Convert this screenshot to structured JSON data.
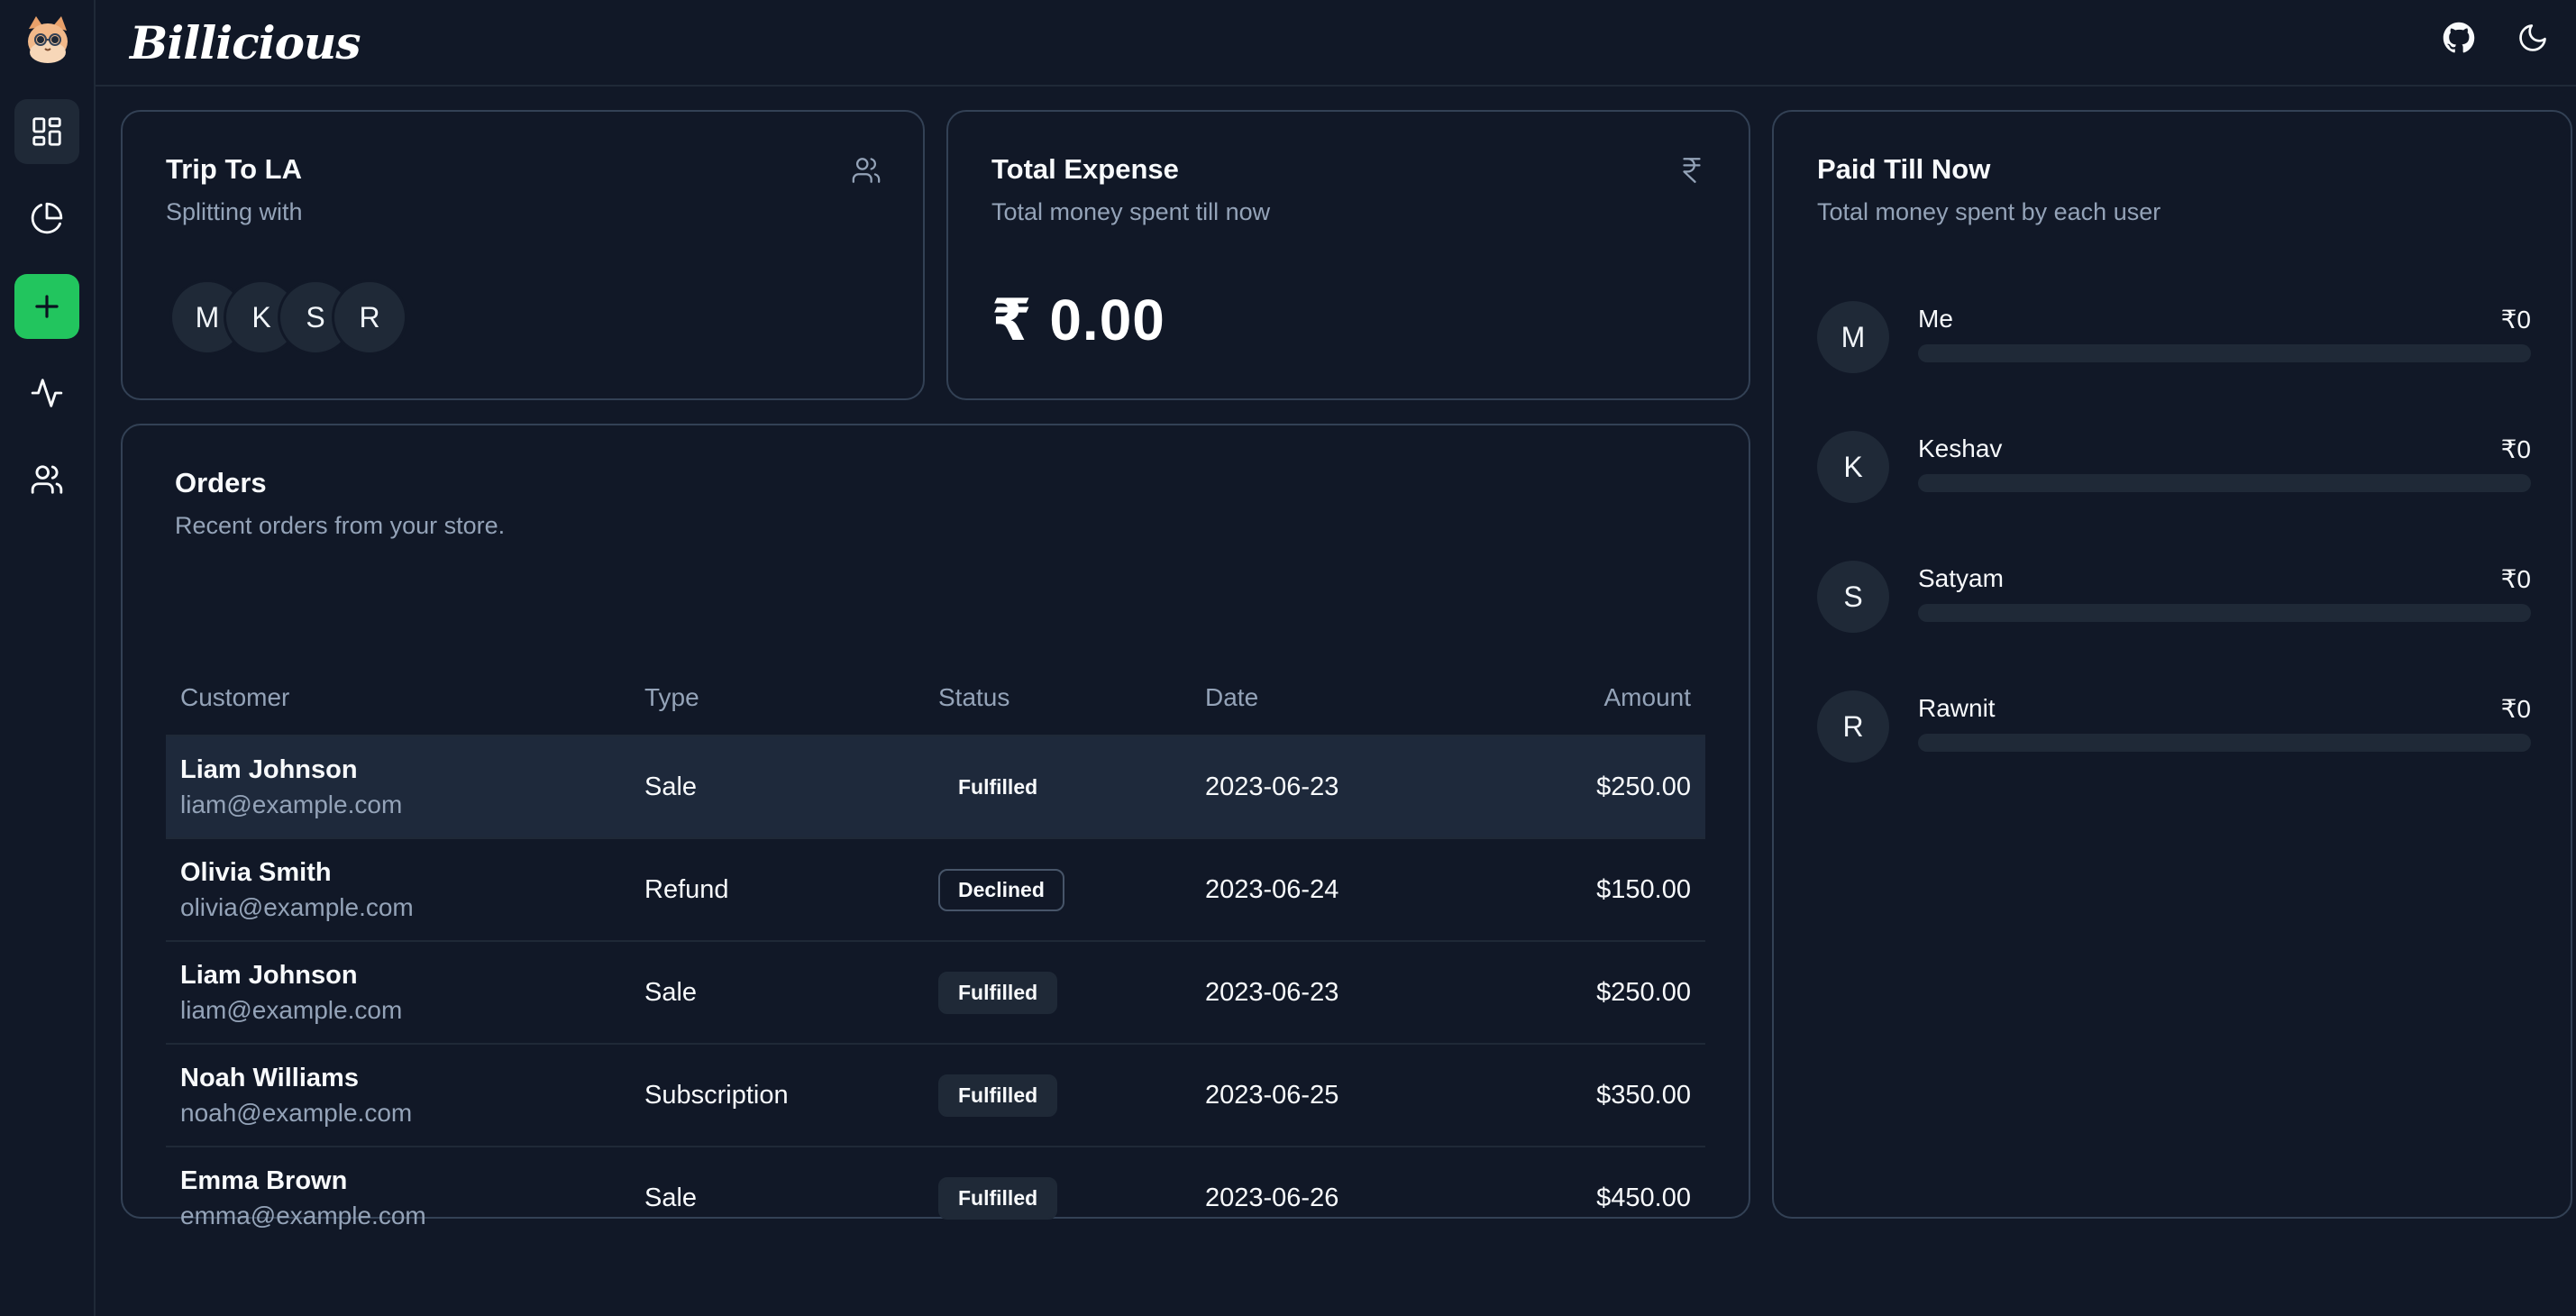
{
  "app": {
    "brand": "Billicious"
  },
  "sidebar": {
    "items": [
      {
        "name": "dashboard",
        "icon": "dashboard-icon"
      },
      {
        "name": "analytics",
        "icon": "pie-chart-icon"
      },
      {
        "name": "add",
        "icon": "plus-icon"
      },
      {
        "name": "activity",
        "icon": "activity-icon"
      },
      {
        "name": "members",
        "icon": "users-icon"
      }
    ]
  },
  "topbar": {
    "icons": [
      "github-icon",
      "moon-icon"
    ]
  },
  "trip_card": {
    "title": "Trip To LA",
    "subtitle": "Splitting with",
    "members": [
      "M",
      "K",
      "S",
      "R"
    ]
  },
  "expense_card": {
    "title": "Total Expense",
    "subtitle": "Total money spent till now",
    "amount": "₹ 0.00"
  },
  "orders": {
    "title": "Orders",
    "subtitle": "Recent orders from your store.",
    "columns": [
      "Customer",
      "Type",
      "Status",
      "Date",
      "Amount"
    ],
    "rows": [
      {
        "name": "Liam Johnson",
        "email": "liam@example.com",
        "type": "Sale",
        "status": "Fulfilled",
        "date": "2023-06-23",
        "amount": "$250.00"
      },
      {
        "name": "Olivia Smith",
        "email": "olivia@example.com",
        "type": "Refund",
        "status": "Declined",
        "date": "2023-06-24",
        "amount": "$150.00"
      },
      {
        "name": "Liam Johnson",
        "email": "liam@example.com",
        "type": "Sale",
        "status": "Fulfilled",
        "date": "2023-06-23",
        "amount": "$250.00"
      },
      {
        "name": "Noah Williams",
        "email": "noah@example.com",
        "type": "Subscription",
        "status": "Fulfilled",
        "date": "2023-06-25",
        "amount": "$350.00"
      },
      {
        "name": "Emma Brown",
        "email": "emma@example.com",
        "type": "Sale",
        "status": "Fulfilled",
        "date": "2023-06-26",
        "amount": "$450.00"
      }
    ]
  },
  "paid_card": {
    "title": "Paid Till Now",
    "subtitle": "Total money spent by each user",
    "users": [
      {
        "initial": "M",
        "name": "Me",
        "amount": "₹0",
        "progress": 0
      },
      {
        "initial": "K",
        "name": "Keshav",
        "amount": "₹0",
        "progress": 0
      },
      {
        "initial": "S",
        "name": "Satyam",
        "amount": "₹0",
        "progress": 0
      },
      {
        "initial": "R",
        "name": "Rawnit",
        "amount": "₹0",
        "progress": 0
      }
    ]
  },
  "colors": {
    "background": "#111827",
    "border": "#334155",
    "accent": "#22c55e",
    "muted_text": "#94a3b8"
  }
}
